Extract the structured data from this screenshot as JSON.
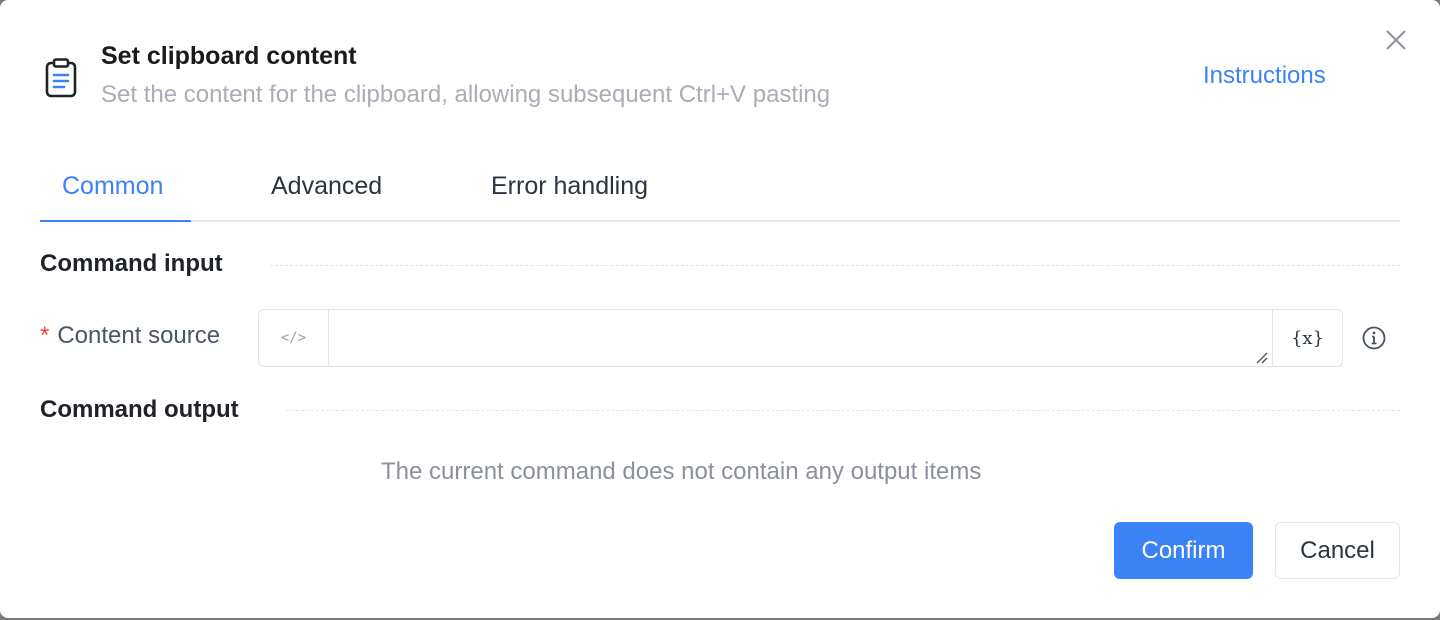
{
  "dialog": {
    "title": "Set clipboard content",
    "subtitle": "Set the content for the clipboard, allowing subsequent Ctrl+V pasting",
    "instructions_link": "Instructions",
    "close_icon": "close-icon",
    "header_icon": "clipboard-icon"
  },
  "tabs": [
    {
      "label": "Common",
      "active": true
    },
    {
      "label": "Advanced",
      "active": false
    },
    {
      "label": "Error handling",
      "active": false
    }
  ],
  "command_input": {
    "section_title": "Command input",
    "fields": [
      {
        "required_mark": "*",
        "label": "Content source",
        "value": "",
        "prefix_glyph": "</>",
        "suffix_glyph": "{x}"
      }
    ]
  },
  "command_output": {
    "section_title": "Command output",
    "empty_message": "The current command does not contain any output items"
  },
  "footer": {
    "confirm_label": "Confirm",
    "cancel_label": "Cancel"
  },
  "colors": {
    "accent": "#3b82f6",
    "required": "#ef4444",
    "muted_text": "#a9adb5"
  }
}
